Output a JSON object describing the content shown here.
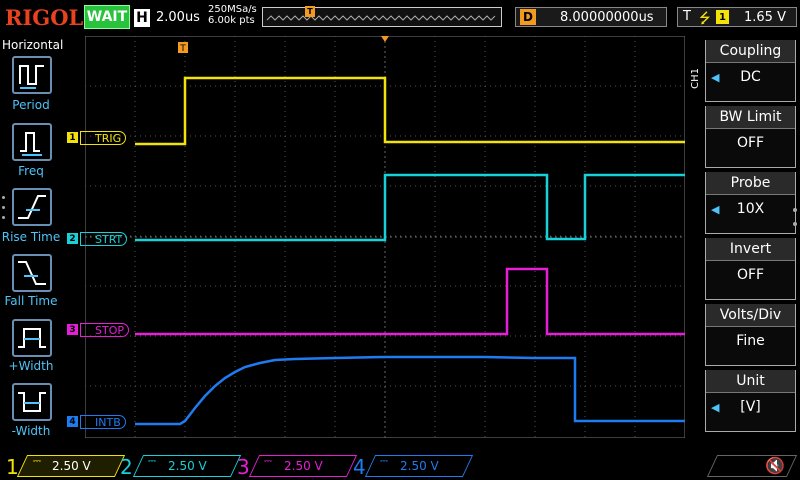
{
  "brand": "RIGOL",
  "status": "WAIT",
  "horizontal": {
    "badge": "H",
    "timebase": "2.00us",
    "sample_rate": "250MSa/s",
    "points": "6.00k pts"
  },
  "delay": {
    "badge": "D",
    "value": "8.00000000us"
  },
  "trigger": {
    "badge": "T",
    "source": "1",
    "level": "1.65 V"
  },
  "left_menu": {
    "title": "Horizontal",
    "items": [
      "Period",
      "Freq",
      "Rise Time",
      "Fall Time",
      "+Width",
      "-Width"
    ]
  },
  "right_menu": {
    "channel_tab": "CH1",
    "items": [
      {
        "title": "Coupling",
        "value": "DC",
        "arrow": true
      },
      {
        "title": "BW Limit",
        "value": "OFF",
        "arrow": false
      },
      {
        "title": "Probe",
        "value": "10X",
        "arrow": true
      },
      {
        "title": "Invert",
        "value": "OFF",
        "arrow": false
      },
      {
        "title": "Volts/Div",
        "value": "Fine",
        "arrow": false
      },
      {
        "title": "Unit",
        "value": "[V]",
        "arrow": true
      }
    ]
  },
  "channels": [
    {
      "num": "1",
      "label": "TRIG",
      "scale": "2.50 V",
      "color": "#f3e20a"
    },
    {
      "num": "2",
      "label": "STRT",
      "scale": "2.50 V",
      "color": "#17d0d8"
    },
    {
      "num": "3",
      "label": "STOP",
      "scale": "2.50 V",
      "color": "#e51fd6"
    },
    {
      "num": "4",
      "label": "INTB",
      "scale": "2.50 V",
      "color": "#1e7bf0"
    }
  ],
  "markers": {
    "trigger_pos": "T"
  }
}
